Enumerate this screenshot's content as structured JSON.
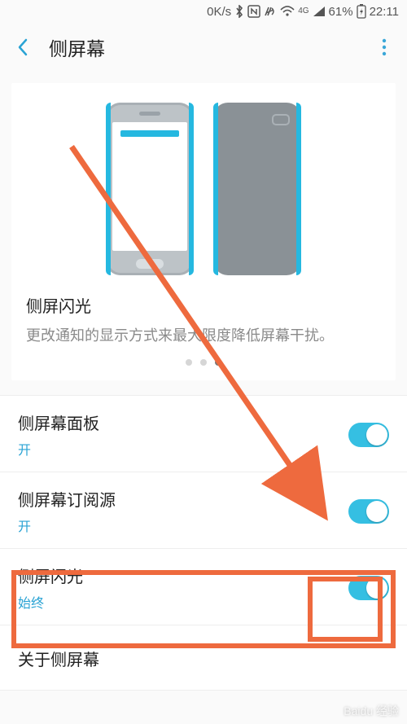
{
  "status": {
    "speed": "0K/s",
    "battery_pct": "61%",
    "time": "22:11",
    "signal_label": "4G"
  },
  "header": {
    "title": "侧屏幕"
  },
  "banner": {
    "feature_title": "侧屏闪光",
    "feature_desc": "更改通知的显示方式来最大限度降低屏幕干扰。",
    "page_count": 3,
    "active_page_index": 2
  },
  "rows": [
    {
      "label": "侧屏幕面板",
      "sub": "开",
      "toggle_on": true
    },
    {
      "label": "侧屏幕订阅源",
      "sub": "开",
      "toggle_on": true
    },
    {
      "label": "侧屏闪光",
      "sub": "始终",
      "toggle_on": true
    },
    {
      "label": "关于侧屏幕",
      "sub": null,
      "toggle_on": null
    }
  ],
  "watermark": "Baidu 经验"
}
